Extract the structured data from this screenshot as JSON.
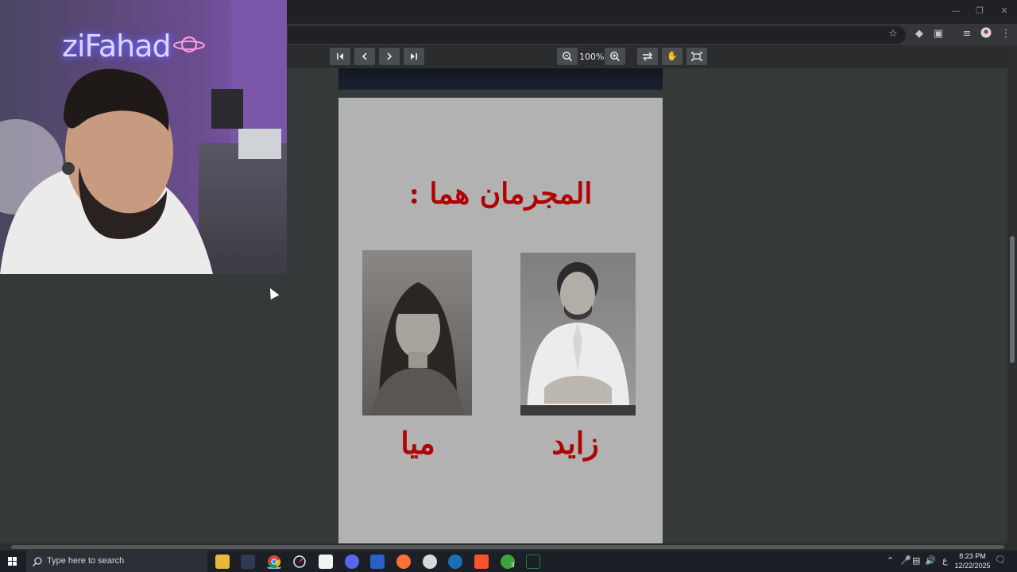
{
  "pdf_toolbar": {
    "zoom": "100%",
    "buttons": [
      "first-page",
      "previous-page",
      "next-page",
      "last-page",
      "zoom-out",
      "zoom-in",
      "rotate",
      "select-tool",
      "fit-screen"
    ]
  },
  "page": {
    "heading": "المجرمان هما :",
    "people": [
      {
        "name": "ميا"
      },
      {
        "name": "زايد"
      }
    ]
  },
  "webcam": {
    "neon_sign": "ziFahad"
  },
  "taskbar": {
    "search_placeholder": "Type here to search",
    "time": "8:23 PM",
    "date": "12/22/2025",
    "lang": "ع",
    "xbox_badge": "3"
  },
  "colors": {
    "accent_red": "#b00000",
    "page_bg": "#b2b2b2",
    "viewer_bg": "#35393a"
  }
}
